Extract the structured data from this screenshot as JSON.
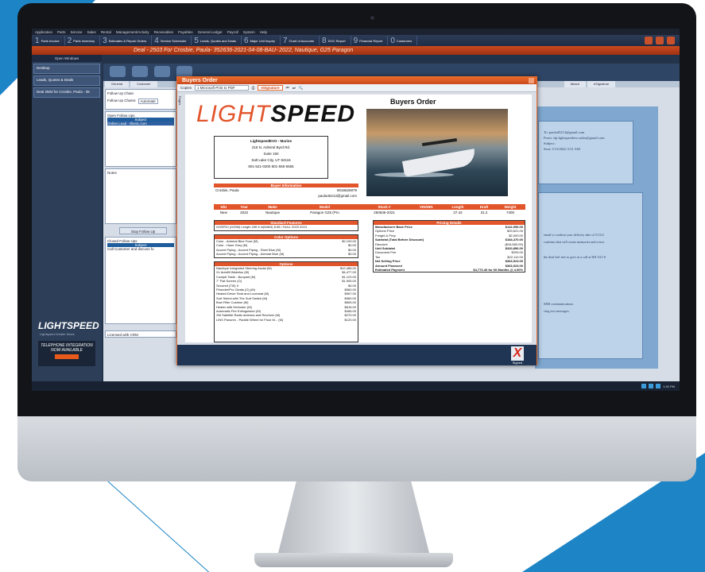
{
  "menu": [
    "Application",
    "Parts",
    "Service",
    "Sales",
    "Rental",
    "Management/Activity",
    "Receivables",
    "Payables",
    "General Ledger",
    "Payroll",
    "System",
    "Help"
  ],
  "shortcuts": [
    {
      "n": "1",
      "label": "Parts Invoice"
    },
    {
      "n": "2",
      "label": "Parts Inventory"
    },
    {
      "n": "3",
      "label": "Estimates & Repair Orders"
    },
    {
      "n": "4",
      "label": "Service Scheduler"
    },
    {
      "n": "5",
      "label": "Leads, Quotes and Deals"
    },
    {
      "n": "6",
      "label": "Major Unit Inquiry"
    },
    {
      "n": "7",
      "label": "Chart of Accounts"
    },
    {
      "n": "8",
      "label": "DOC Report"
    },
    {
      "n": "9",
      "label": "Financial Report"
    },
    {
      "n": "0",
      "label": "Customers"
    }
  ],
  "deal_title": "Deal - 2503 For Crosbie, Paula- 352636-2021-04-08-BAU- 2022, Nautique, G25 Paragon",
  "left": {
    "header": "Open Windows",
    "tabs": [
      "Desktop",
      "Leads, Quotes & Deals",
      "Deal 2503 for Crosbie, Paula - 35"
    ],
    "brand": "LIGHTSPEED",
    "brand_sub": "Lightspeed Dealer News",
    "promo": "TELEPHONE INTEGRATION NOW AVAILABLE"
  },
  "tabs": [
    "General",
    "Customer"
  ],
  "right_tabs": [
    "Attach",
    "eSignature"
  ],
  "followup": {
    "chain_label": "Follow Up Chain",
    "chains_label": "Follow Up Chains:",
    "chains_value": "Automate",
    "open_label": "Open Follow Ups",
    "subject_header": "Subject",
    "open_item": "Online Lead - tlbotic.com",
    "notes_label": "Notes",
    "stop_button": "Stop Follow Up",
    "closed_label": "Closed Follow Ups",
    "closed_item": "Call Customer and discuss fo",
    "licensed": "Licensed with CRM"
  },
  "email": {
    "to": "To: paula45213@gmail.com",
    "from": "From: slp.lightspeedevo.sales@gmail.com",
    "subject": "Subject:",
    "sent": "Sent: 5/13/2022 5:51 AM"
  },
  "email2": [
    "email to confirm your delivery date of 5/13/2",
    "confirms that will create memories and a new",
    "the deal feel free to give us a call at 801-521-0",
    "SMS communications",
    "ving text messages."
  ],
  "dialog": {
    "title": "Buyers Order",
    "copies_label": "Copies",
    "printer": "1 Microsoft Print to PDF",
    "esig": "eSignature",
    "pages_label": "Pages",
    "doc_title": "Buyers Order",
    "logo_light": "LIGHT",
    "logo_speed": "SPEED",
    "dealer": [
      "LightspeedEVO - Marine",
      "216 N. Admiral Byrd Rd.",
      "Suite 150",
      "Salt Lake City, UT 84116",
      "801-521-0300 801-555-5555"
    ],
    "buyer_header": "Buyer Information",
    "buyer_name": "Crosbie, Paula",
    "buyer_phone": "8016626979",
    "buyer_email": "paula45213@gmail.com",
    "vehicle_cols": [
      "N/U",
      "Year",
      "Make",
      "Model",
      "Stock #",
      "VIN/HIN",
      "Length",
      "Draft",
      "Weight"
    ],
    "vehicle_row": [
      "New",
      "2022",
      "Nautique",
      "Paragon G25 (Pro",
      "250636-2021",
      "",
      "27.42",
      "31.2",
      "7400"
    ],
    "std_header": "Standard Features",
    "std_text": "GG5P20 (G25M) Length 24ft 6 in(MAIN) 8.58 / HULL 2023 2024",
    "color_header": "Color Options",
    "colors": [
      {
        "name": "Color - Admiral Blue Fuse (M)",
        "price": "$2,193.00"
      },
      {
        "name": "Color - Haze Grey (M)",
        "price": "$0.00"
      },
      {
        "name": "Accent Piping - Accent Piping - Steel Blue (M)",
        "price": "$0.00"
      },
      {
        "name": "Accent Piping - Accent Piping - Admiral Blue (M)",
        "price": "$0.00"
      }
    ],
    "options_header": "Options",
    "options": [
      {
        "name": "Nautique Integrated Steering Assist (M)",
        "price": "$12,485.00"
      },
      {
        "name": "XL Autofill Wakefus (M)",
        "price": "$4,477.00"
      },
      {
        "name": "Cockpit Table - Buoyant (M)",
        "price": "$1,123.00"
      },
      {
        "name": "7\" Flat Screen (O)",
        "price": "$1,905.00"
      },
      {
        "name": "Secured (TI0) II",
        "price": "$0.00"
      },
      {
        "name": "Phunder/Pro Cleats (O) (M)",
        "price": "$560.00"
      },
      {
        "name": "Heated Driver Seat and Loveseat (M)",
        "price": "$967.00"
      },
      {
        "name": "Surf Select with The Surf Switch (M)",
        "price": "$960.00"
      },
      {
        "name": "Bow Filler Cushion (M)",
        "price": "$805.00"
      },
      {
        "name": "Heater with Defroster (M)",
        "price": "$616.00"
      },
      {
        "name": "Automatic Fire Extinguisher (M)",
        "price": "$456.00"
      },
      {
        "name": "XM Satellite Radio antenna and Receiver (M)",
        "price": "$270.00"
      },
      {
        "name": "LINS Panorex - Paddle Wheel for Floor M... (M)",
        "price": "$120.00"
      }
    ],
    "pricing_header": "Pricing Details",
    "pricing": [
      {
        "name": "Manufacturer Base Price",
        "price": "$142,956.00",
        "bold": true
      },
      {
        "name": "Options Price",
        "price": "$29,621.00",
        "bold": false
      },
      {
        "name": "Freight & Prep",
        "price": "$2,000.00",
        "bold": false
      },
      {
        "name": "Subtotal (Total Before Discount)",
        "price": "$184,470.00",
        "bold": true
      },
      {
        "name": "Discount",
        "price": "($16,583.00)",
        "bold": false
      },
      {
        "name": "Unit Subtotal",
        "price": "$320,856.00",
        "bold": true
      },
      {
        "name": "Document Fee",
        "price": "$299.00",
        "bold": false
      },
      {
        "name": "Tax",
        "price": "$22,112.00",
        "bold": false
      },
      {
        "name": "Net Selling Price",
        "price": "$363,923.00",
        "bold": true
      },
      {
        "name": "Amount Financed",
        "price": "$363,923.00",
        "bold": true
      },
      {
        "name": "Estimated Payment",
        "price": "$4,773.40 for 60 Months @ 4.00%",
        "bold": true
      }
    ],
    "signed": "Signed"
  },
  "taskbar_time": "1:30 PM",
  "colors": {
    "accent": "#e2542a",
    "brand_blue": "#1d84c6"
  }
}
